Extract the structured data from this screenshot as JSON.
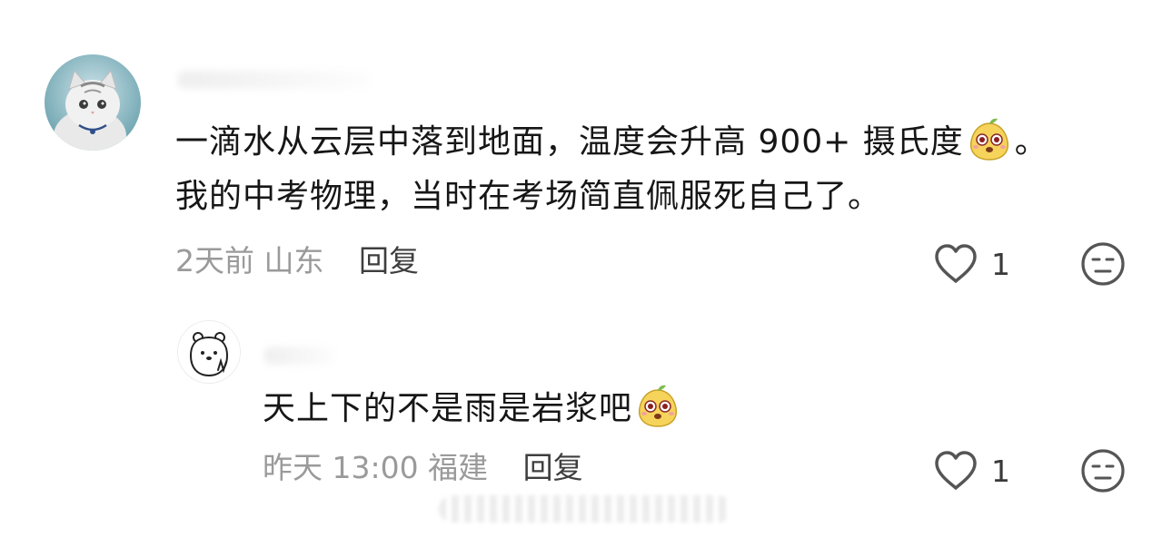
{
  "comments": [
    {
      "avatar_icon": "cat-photo-avatar",
      "text_line1_before_emoji": "一滴水从云层中落到地面，温度会升高 900+ 摄氏度",
      "text_line1_after_emoji": "。",
      "text_line2": "我的中考物理，当时在考场简直佩服死自己了。",
      "emoji_icon": "pear-face-emoji",
      "time": "2天前",
      "location": "山东",
      "reply_label": "回复",
      "like_count": "1"
    },
    {
      "avatar_icon": "bear-doodle-avatar",
      "text_before_emoji": "天上下的不是雨是岩浆吧",
      "emoji_icon": "pear-face-emoji",
      "time": "昨天 13:00",
      "location": "福建",
      "reply_label": "回复",
      "like_count": "1"
    }
  ],
  "colors": {
    "text": "#161616",
    "meta": "#9a9a9a",
    "reply": "#3e3e3e",
    "icon_stroke": "#555555"
  }
}
